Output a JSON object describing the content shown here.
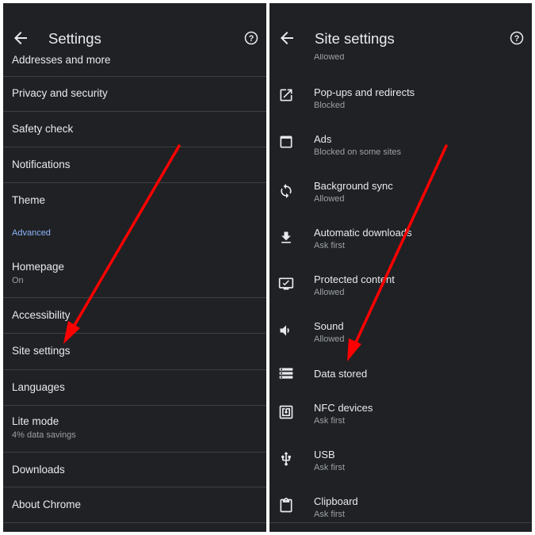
{
  "left": {
    "title": "Settings",
    "top_item": "Addresses and more",
    "items": [
      {
        "label": "Privacy and security"
      },
      {
        "label": "Safety check"
      },
      {
        "label": "Notifications"
      },
      {
        "label": "Theme"
      }
    ],
    "section_header": "Advanced",
    "advanced_items": [
      {
        "label": "Homepage",
        "sub": "On"
      },
      {
        "label": "Accessibility"
      },
      {
        "label": "Site settings"
      },
      {
        "label": "Languages"
      },
      {
        "label": "Lite mode",
        "sub": "4% data savings"
      },
      {
        "label": "Downloads"
      },
      {
        "label": "About Chrome"
      }
    ]
  },
  "right": {
    "title": "Site settings",
    "top_item_sub": "Allowed",
    "items": [
      {
        "icon": "open-in-new-icon",
        "label": "Pop-ups and redirects",
        "sub": "Blocked"
      },
      {
        "icon": "ads-window-icon",
        "label": "Ads",
        "sub": "Blocked on some sites"
      },
      {
        "icon": "sync-icon",
        "label": "Background sync",
        "sub": "Allowed"
      },
      {
        "icon": "download-icon",
        "label": "Automatic downloads",
        "sub": "Ask first"
      },
      {
        "icon": "protected-content-icon",
        "label": "Protected content",
        "sub": "Allowed"
      },
      {
        "icon": "volume-icon",
        "label": "Sound",
        "sub": "Allowed"
      },
      {
        "icon": "storage-icon",
        "label": "Data stored",
        "sub": ""
      },
      {
        "icon": "nfc-icon",
        "label": "NFC devices",
        "sub": "Ask first"
      },
      {
        "icon": "usb-icon",
        "label": "USB",
        "sub": "Ask first"
      },
      {
        "icon": "clipboard-icon",
        "label": "Clipboard",
        "sub": "Ask first"
      }
    ]
  },
  "colors": {
    "background": "#202124",
    "text": "#e8eaed",
    "secondary_text": "#9aa0a6",
    "accent": "#8ab4f8",
    "divider": "#3c4043",
    "annotation_arrow": "#ff0000"
  }
}
